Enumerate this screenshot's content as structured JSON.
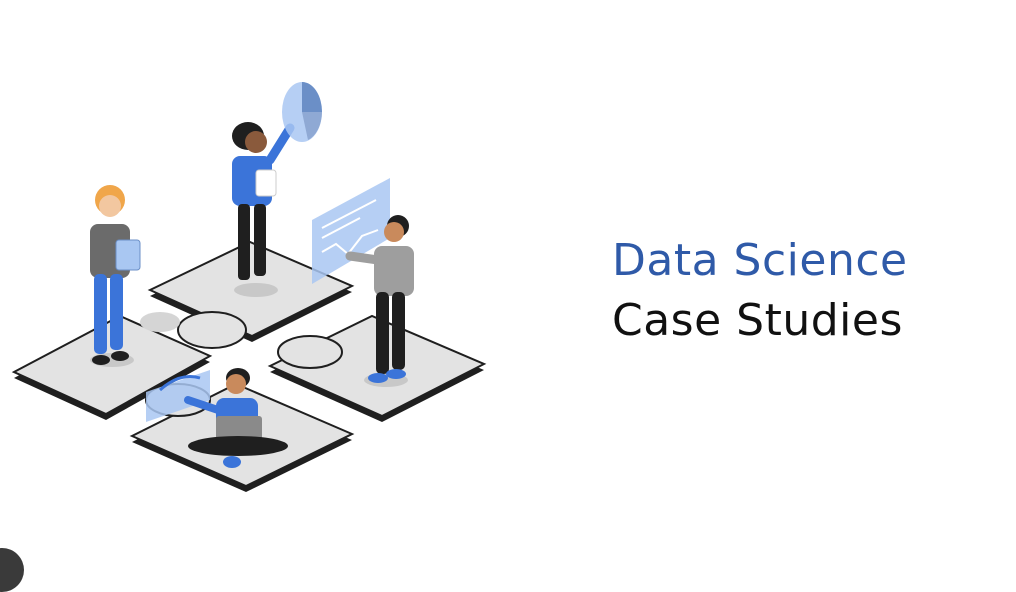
{
  "title": {
    "line1": "Data Science",
    "line2": "Case Studies"
  },
  "colors": {
    "accent_blue": "#2f5aa8",
    "text_dark": "#111111",
    "puzzle_gray": "#e3e3e3",
    "puzzle_edge": "#1f1f1f",
    "shirt_blue": "#3b74d9",
    "panel_blue": "#a9c7f2"
  },
  "illustration": {
    "subject": "team-on-puzzle-pieces",
    "icons": [
      "pie-chart-icon",
      "line-chart-panel-icon",
      "tablet-icon",
      "laptop-icon"
    ]
  }
}
